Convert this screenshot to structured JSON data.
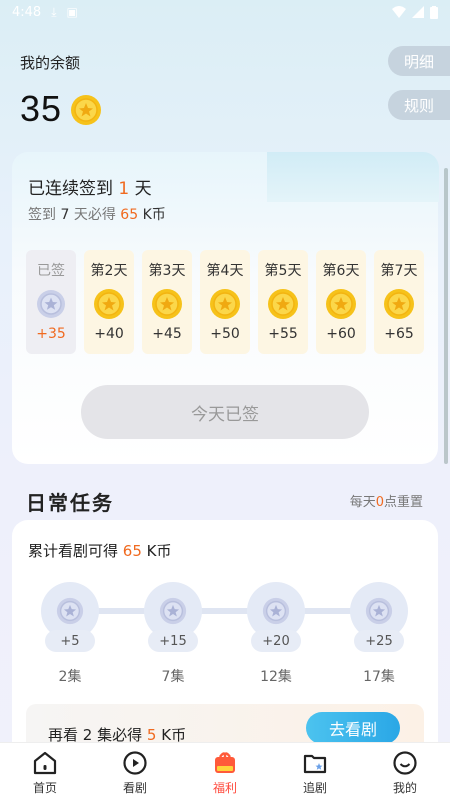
{
  "status_bar": {
    "time": "4:48"
  },
  "balance": {
    "label": "我的余额",
    "value": "35"
  },
  "header_buttons": {
    "detail": "明细",
    "rules": "规则"
  },
  "checkin": {
    "title_prefix": "已连续签到",
    "streak_days": "1",
    "title_suffix": "天",
    "sub_prefix": "签到",
    "sub_days": "7",
    "sub_mid": "天必得",
    "sub_reward": "65",
    "sub_unit": "K币",
    "days": [
      {
        "label": "已签",
        "reward": "+35",
        "done": true
      },
      {
        "label": "第2天",
        "reward": "+40",
        "done": false
      },
      {
        "label": "第3天",
        "reward": "+45",
        "done": false
      },
      {
        "label": "第4天",
        "reward": "+50",
        "done": false
      },
      {
        "label": "第5天",
        "reward": "+55",
        "done": false
      },
      {
        "label": "第6天",
        "reward": "+60",
        "done": false
      },
      {
        "label": "第7天",
        "reward": "+65",
        "done": false
      }
    ],
    "button_label": "今天已签"
  },
  "daily_tasks": {
    "title": "日常任务",
    "reset_prefix": "每天",
    "reset_hour": "0",
    "reset_suffix": "点重置",
    "task_title_prefix": "累计看剧可得",
    "task_reward": "65",
    "task_unit": "K币",
    "milestones": [
      {
        "reward": "+5",
        "label": "2集"
      },
      {
        "reward": "+15",
        "label": "7集"
      },
      {
        "reward": "+20",
        "label": "12集"
      },
      {
        "reward": "+25",
        "label": "17集"
      }
    ],
    "banner_prefix": "再看",
    "banner_count": "2",
    "banner_mid": "集必得",
    "banner_reward": "5",
    "banner_unit": "K币",
    "banner_button": "去看剧"
  },
  "bottom_nav": {
    "items": [
      {
        "label": "首页",
        "icon": "home-icon",
        "active": false
      },
      {
        "label": "看剧",
        "icon": "play-icon",
        "active": false
      },
      {
        "label": "福利",
        "icon": "gift-icon",
        "active": true
      },
      {
        "label": "追剧",
        "icon": "folder-star-icon",
        "active": false
      },
      {
        "label": "我的",
        "icon": "profile-icon",
        "active": false
      }
    ]
  },
  "colors": {
    "accent_orange": "#f06a20",
    "nav_active": "#ff4a3d",
    "watch_button": "#2aa7e6",
    "coin_gold": "#f6c21a"
  }
}
